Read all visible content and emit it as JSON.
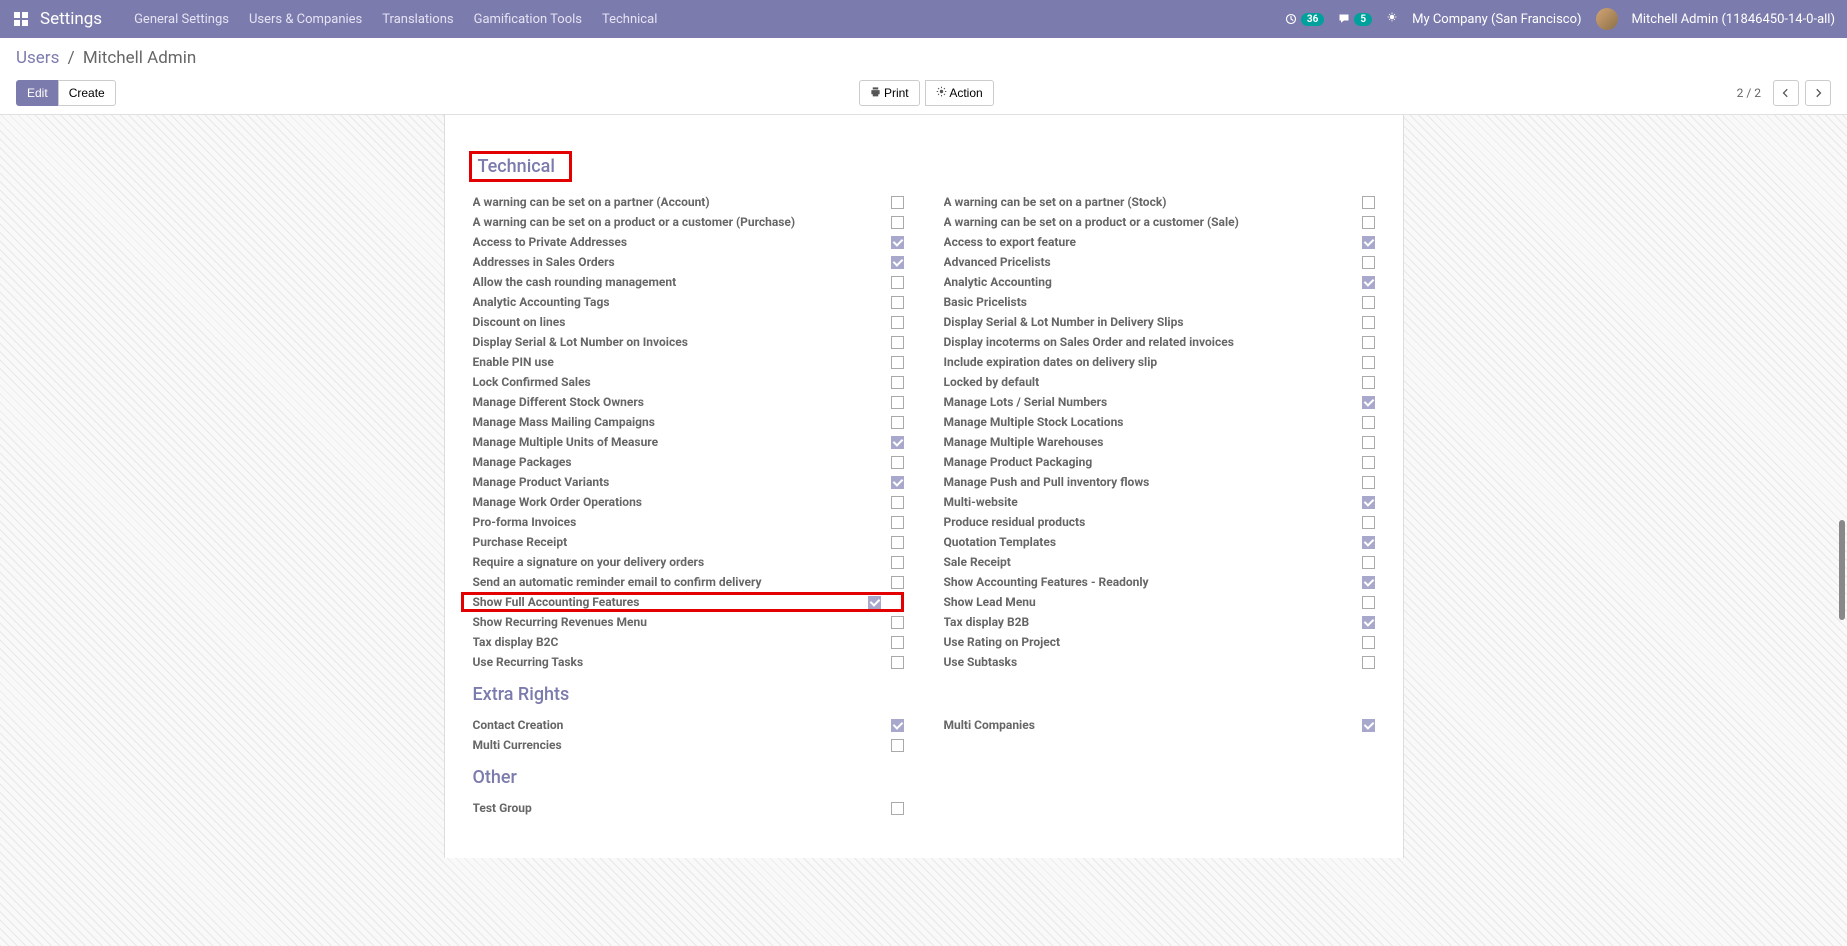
{
  "nav": {
    "title": "Settings",
    "links": [
      "General Settings",
      "Users & Companies",
      "Translations",
      "Gamification Tools",
      "Technical"
    ],
    "badge1": "36",
    "badge2": "5",
    "company": "My Company (San Francisco)",
    "user": "Mitchell Admin (11846450-14-0-all)"
  },
  "breadcrumb": {
    "parent": "Users",
    "current": "Mitchell Admin"
  },
  "toolbar": {
    "edit": "Edit",
    "create": "Create",
    "print": "Print",
    "action": "Action",
    "pager": "2 / 2"
  },
  "sections": {
    "technical": "Technical",
    "extra_rights": "Extra Rights",
    "other": "Other"
  },
  "technical_left": [
    {
      "label": "A warning can be set on a partner (Account)",
      "checked": false
    },
    {
      "label": "A warning can be set on a product or a customer (Purchase)",
      "checked": false
    },
    {
      "label": "Access to Private Addresses",
      "checked": true
    },
    {
      "label": "Addresses in Sales Orders",
      "checked": true
    },
    {
      "label": "Allow the cash rounding management",
      "checked": false
    },
    {
      "label": "Analytic Accounting Tags",
      "checked": false
    },
    {
      "label": "Discount on lines",
      "checked": false
    },
    {
      "label": "Display Serial & Lot Number on Invoices",
      "checked": false
    },
    {
      "label": "Enable PIN use",
      "checked": false
    },
    {
      "label": "Lock Confirmed Sales",
      "checked": false
    },
    {
      "label": "Manage Different Stock Owners",
      "checked": false
    },
    {
      "label": "Manage Mass Mailing Campaigns",
      "checked": false
    },
    {
      "label": "Manage Multiple Units of Measure",
      "checked": true
    },
    {
      "label": "Manage Packages",
      "checked": false
    },
    {
      "label": "Manage Product Variants",
      "checked": true
    },
    {
      "label": "Manage Work Order Operations",
      "checked": false
    },
    {
      "label": "Pro-forma Invoices",
      "checked": false
    },
    {
      "label": "Purchase Receipt",
      "checked": false
    },
    {
      "label": "Require a signature on your delivery orders",
      "checked": false
    },
    {
      "label": "Send an automatic reminder email to confirm delivery",
      "checked": false
    },
    {
      "label": "Show Full Accounting Features",
      "checked": true,
      "highlight": true
    },
    {
      "label": "Show Recurring Revenues Menu",
      "checked": false
    },
    {
      "label": "Tax display B2C",
      "checked": false
    },
    {
      "label": "Use Recurring Tasks",
      "checked": false
    }
  ],
  "technical_right": [
    {
      "label": "A warning can be set on a partner (Stock)",
      "checked": false
    },
    {
      "label": "A warning can be set on a product or a customer (Sale)",
      "checked": false
    },
    {
      "label": "Access to export feature",
      "checked": true
    },
    {
      "label": "Advanced Pricelists",
      "checked": false
    },
    {
      "label": "Analytic Accounting",
      "checked": true
    },
    {
      "label": "Basic Pricelists",
      "checked": false
    },
    {
      "label": "Display Serial & Lot Number in Delivery Slips",
      "checked": false
    },
    {
      "label": "Display incoterms on Sales Order and related invoices",
      "checked": false
    },
    {
      "label": "Include expiration dates on delivery slip",
      "checked": false
    },
    {
      "label": "Locked by default",
      "checked": false
    },
    {
      "label": "Manage Lots / Serial Numbers",
      "checked": true
    },
    {
      "label": "Manage Multiple Stock Locations",
      "checked": false
    },
    {
      "label": "Manage Multiple Warehouses",
      "checked": false
    },
    {
      "label": "Manage Product Packaging",
      "checked": false
    },
    {
      "label": "Manage Push and Pull inventory flows",
      "checked": false
    },
    {
      "label": "Multi-website",
      "checked": true
    },
    {
      "label": "Produce residual products",
      "checked": false
    },
    {
      "label": "Quotation Templates",
      "checked": true
    },
    {
      "label": "Sale Receipt",
      "checked": false
    },
    {
      "label": "Show Accounting Features - Readonly",
      "checked": true
    },
    {
      "label": "Show Lead Menu",
      "checked": false
    },
    {
      "label": "Tax display B2B",
      "checked": true
    },
    {
      "label": "Use Rating on Project",
      "checked": false
    },
    {
      "label": "Use Subtasks",
      "checked": false
    }
  ],
  "extra_left": [
    {
      "label": "Contact Creation",
      "checked": true
    },
    {
      "label": "Multi Currencies",
      "checked": false
    }
  ],
  "extra_right": [
    {
      "label": "Multi Companies",
      "checked": true
    }
  ],
  "other_left": [
    {
      "label": "Test Group",
      "checked": false
    }
  ]
}
